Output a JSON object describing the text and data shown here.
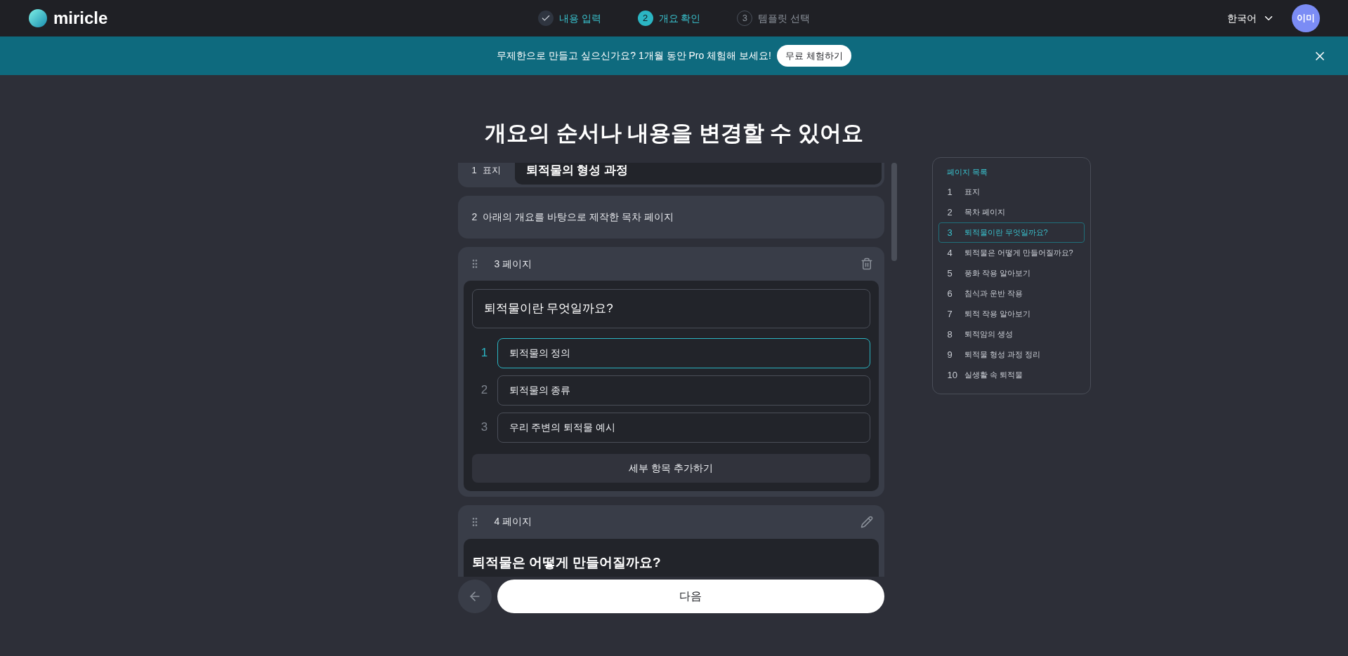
{
  "header": {
    "logo": "miricle",
    "steps": [
      {
        "label": "내용 입력",
        "completed": true,
        "selected": false
      },
      {
        "number": "2",
        "label": "개요 확인",
        "completed": false,
        "selected": true
      },
      {
        "number": "3",
        "label": "템플릿 선택",
        "completed": false,
        "selected": false
      }
    ],
    "language": "한국어",
    "avatar": "이미"
  },
  "banner": {
    "text": "무제한으로 만들고 싶으신가요? 1개월 동안 Pro 체험해 보세요!",
    "button": "무료 체험하기"
  },
  "title": "개요의 순서나 내용을 변경할 수 있어요",
  "pages": [
    {
      "kind": "cover",
      "number": "1",
      "label": "표지",
      "title": "퇴적물의 형성 과정"
    },
    {
      "kind": "toc",
      "number": "2",
      "label": "아래의 개요를 바탕으로 제작한 목차 페이지"
    },
    {
      "kind": "page",
      "number": "3",
      "label": "페이지",
      "deletable": true,
      "editable": false,
      "title": "퇴적물이란 무엇일까요?",
      "items": [
        {
          "number": "1",
          "text": "퇴적물의 정의",
          "focused": true
        },
        {
          "number": "2",
          "text": "퇴적물의 종류",
          "focused": false
        },
        {
          "number": "3",
          "text": "우리 주변의 퇴적물 예시",
          "focused": false
        }
      ],
      "add_button": "세부 항목 추가하기"
    },
    {
      "kind": "page",
      "number": "4",
      "label": "페이지",
      "deletable": false,
      "editable": true,
      "title": "퇴적물은 어떻게 만들어질까요?"
    }
  ],
  "next_button": "다음",
  "page_list": {
    "title": "페이지 목록",
    "items": [
      {
        "number": "1",
        "label": "표지",
        "selected": false
      },
      {
        "number": "2",
        "label": "목차 페이지",
        "selected": false
      },
      {
        "number": "3",
        "label": "퇴적물이란 무엇일까요?",
        "selected": true
      },
      {
        "number": "4",
        "label": "퇴적물은 어떻게 만들어질까요?",
        "selected": false
      },
      {
        "number": "5",
        "label": "풍화 작용 알아보기",
        "selected": false
      },
      {
        "number": "6",
        "label": "침식과 운반 작용",
        "selected": false
      },
      {
        "number": "7",
        "label": "퇴적 작용 알아보기",
        "selected": false
      },
      {
        "number": "8",
        "label": "퇴적암의 생성",
        "selected": false
      },
      {
        "number": "9",
        "label": "퇴적물 형성 과정 정리",
        "selected": false
      },
      {
        "number": "10",
        "label": "실생활 속 퇴적물",
        "selected": false
      }
    ]
  }
}
